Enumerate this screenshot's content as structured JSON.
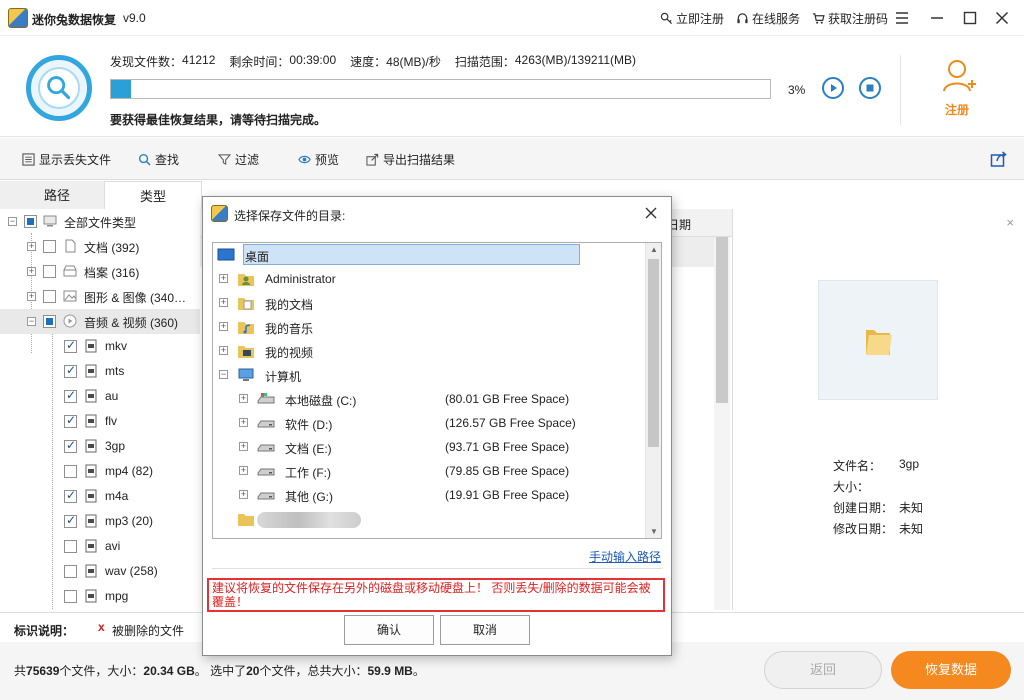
{
  "app": {
    "title": "迷你兔数据恢复",
    "version": "v9.0",
    "links": {
      "register_now": "立即注册",
      "online_service": "在线服务",
      "get_code": "获取注册码"
    }
  },
  "scan": {
    "found_label": "发现文件数：",
    "found_value": "41212",
    "remaining_label": "剩余时间：",
    "remaining_value": "00:39:00",
    "speed_label": "速度：",
    "speed_value": "48(MB)/秒",
    "range_label": "扫描范围：",
    "range_value": "4263(MB)/139211(MB)",
    "percent_text": "3%",
    "progress_fraction": 0.03,
    "tip": "要获得最佳恢复结果，请等待扫描完成。",
    "register_label": "注册"
  },
  "toolbar": {
    "show_lost": "显示丢失文件",
    "find": "查找",
    "filter": "过滤",
    "preview": "预览",
    "export": "导出扫描结果"
  },
  "tabs": {
    "path": "路径",
    "type": "类型"
  },
  "tree": {
    "root": "全部文件类型",
    "docs": "文档 (392)",
    "archives": "档案 (316)",
    "images": "图形 & 图像 (340…",
    "av": "音频 & 视频 (360)",
    "items": [
      {
        "label": "mkv",
        "checked": true
      },
      {
        "label": "mts",
        "checked": true
      },
      {
        "label": "au",
        "checked": true
      },
      {
        "label": "flv",
        "checked": true
      },
      {
        "label": "3gp",
        "checked": true
      },
      {
        "label": "mp4 (82)",
        "checked": false
      },
      {
        "label": "m4a",
        "checked": true
      },
      {
        "label": "mp3 (20)",
        "checked": true
      },
      {
        "label": "avi",
        "checked": false
      },
      {
        "label": "wav (258)",
        "checked": false
      },
      {
        "label": "mpg",
        "checked": false
      }
    ]
  },
  "middle": {
    "col_date": "日期"
  },
  "preview": {
    "file_name_label": "文件名：",
    "file_name": "3gp",
    "size_label": "大小：",
    "size": "",
    "created_label": "创建日期：",
    "created": "未知",
    "modified_label": "修改日期：",
    "modified": "未知"
  },
  "legend": {
    "label": "标识说明：",
    "mark": "x",
    "text": "被删除的文件"
  },
  "status": {
    "prefix": "共",
    "files_count": "75639",
    "files_unit": "个文件，大小：",
    "total_size": "20.34 GB",
    "mid": "。 选中了",
    "selected_count": "20",
    "selected_unit": "个文件，总共大小：",
    "selected_size": "59.9 MB",
    "suffix": "。"
  },
  "buttons": {
    "back": "返回",
    "recover": "恢复数据"
  },
  "dialog": {
    "title": "选择保存文件的目录:",
    "folders": {
      "desktop": "桌面",
      "admin": "Administrator",
      "my_docs": "我的文档",
      "my_music": "我的音乐",
      "my_videos": "我的视频",
      "computer": "计算机"
    },
    "drives": [
      {
        "name": "本地磁盘 (C:)",
        "space": "(80.01 GB Free Space)"
      },
      {
        "name": "软件 (D:)",
        "space": "(126.57 GB Free Space)"
      },
      {
        "name": "文档 (E:)",
        "space": "(93.71 GB Free Space)"
      },
      {
        "name": "工作 (F:)",
        "space": "(79.85 GB Free Space)"
      },
      {
        "name": "其他 (G:)",
        "space": "(19.91 GB Free Space)"
      }
    ],
    "manual_path": "手动输入路径",
    "warning": "建议将恢复的文件保存在另外的磁盘或移动硬盘上！ 否则丢失/删除的数据可能会被覆盖！",
    "ok": "确认",
    "cancel": "取消"
  },
  "colors": {
    "accent_blue": "#2b9fd8",
    "orange": "#f5881f",
    "warning_red": "#e02020"
  }
}
